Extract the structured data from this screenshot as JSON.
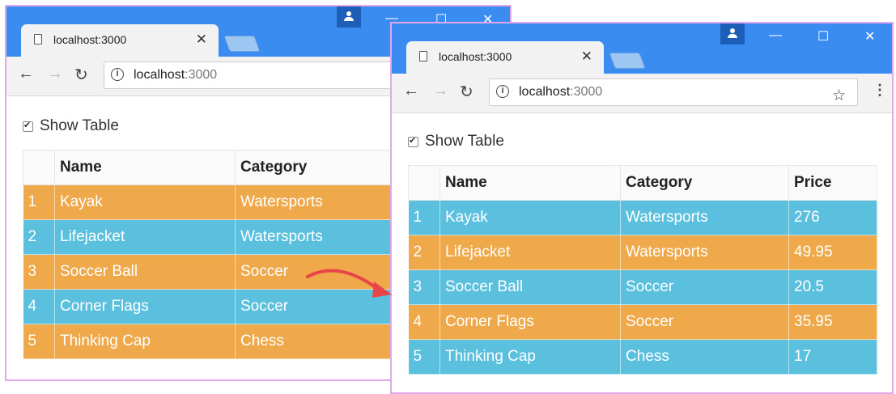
{
  "colors": {
    "orange": "#efa94a",
    "blue": "#5bc0de",
    "chrome": "#3b8cf0"
  },
  "window_back": {
    "tab_title": "localhost:3000",
    "url_host": "localhost",
    "url_port": ":3000",
    "show_table_label": "Show Table",
    "columns": [
      "Name",
      "Category"
    ],
    "rows": [
      {
        "num": "1",
        "name": "Kayak",
        "category": "Watersports",
        "color": "#efa94a"
      },
      {
        "num": "2",
        "name": "Lifejacket",
        "category": "Watersports",
        "color": "#5bc0de"
      },
      {
        "num": "3",
        "name": "Soccer Ball",
        "category": "Soccer",
        "color": "#efa94a"
      },
      {
        "num": "4",
        "name": "Corner Flags",
        "category": "Soccer",
        "color": "#5bc0de"
      },
      {
        "num": "5",
        "name": "Thinking Cap",
        "category": "Chess",
        "color": "#efa94a"
      }
    ]
  },
  "window_front": {
    "tab_title": "localhost:3000",
    "url_host": "localhost",
    "url_port": ":3000",
    "show_table_label": "Show Table",
    "columns": [
      "Name",
      "Category",
      "Price"
    ],
    "rows": [
      {
        "num": "1",
        "name": "Kayak",
        "category": "Watersports",
        "price": "276",
        "color": "#5bc0de"
      },
      {
        "num": "2",
        "name": "Lifejacket",
        "category": "Watersports",
        "price": "49.95",
        "color": "#efa94a"
      },
      {
        "num": "3",
        "name": "Soccer Ball",
        "category": "Soccer",
        "price": "20.5",
        "color": "#5bc0de"
      },
      {
        "num": "4",
        "name": "Corner Flags",
        "category": "Soccer",
        "price": "35.95",
        "color": "#efa94a"
      },
      {
        "num": "5",
        "name": "Thinking Cap",
        "category": "Chess",
        "price": "17",
        "color": "#5bc0de"
      }
    ]
  },
  "icons": [
    "page-icon",
    "close-icon",
    "new-tab-icon",
    "user-icon",
    "minimize-icon",
    "maximize-icon",
    "window-close-icon",
    "back-arrow-icon",
    "forward-arrow-icon",
    "reload-icon",
    "info-icon",
    "bookmark-star-icon",
    "menu-kebab-icon",
    "checkbox-icon",
    "red-arrow-icon"
  ]
}
